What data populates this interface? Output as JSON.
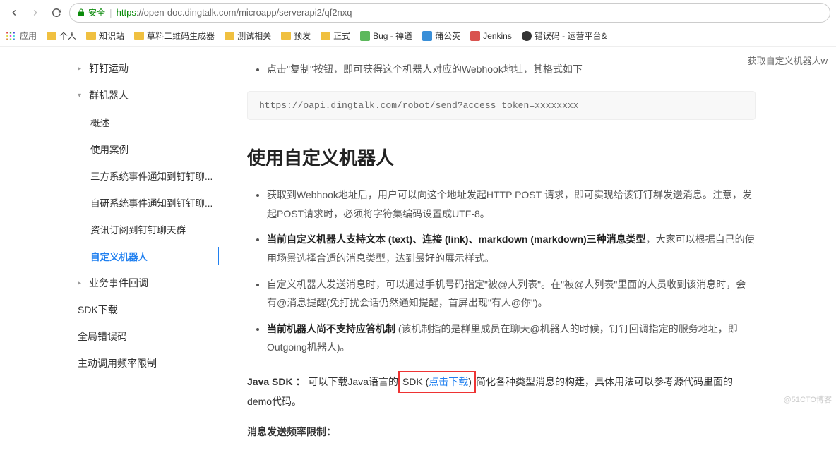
{
  "browser": {
    "secure_label": "安全",
    "url_proto": "https",
    "url_host": "://open-doc.dingtalk.com",
    "url_path": "/microapp/serverapi2/qf2nxq"
  },
  "bookmarks": {
    "apps": "应用",
    "items": [
      {
        "type": "folder",
        "label": "个人"
      },
      {
        "type": "folder",
        "label": "知识站"
      },
      {
        "type": "folder",
        "label": "草料二维码生成器"
      },
      {
        "type": "folder",
        "label": "测试相关"
      },
      {
        "type": "folder",
        "label": "预发"
      },
      {
        "type": "folder",
        "label": "正式"
      },
      {
        "type": "fav",
        "cls": "green",
        "label": "Bug - 禅道"
      },
      {
        "type": "fav",
        "cls": "blue",
        "label": "蒲公英"
      },
      {
        "type": "fav",
        "cls": "red",
        "label": "Jenkins"
      },
      {
        "type": "fav",
        "cls": "yin",
        "label": "错误码 - 运营平台&"
      }
    ]
  },
  "right_header": "获取自定义机器人w",
  "sidebar": {
    "items": [
      {
        "level": "sub",
        "caret": "▸",
        "label": "钉钉运动"
      },
      {
        "level": "sub",
        "caret": "▾",
        "label": "群机器人"
      },
      {
        "level": "sub2",
        "label": "概述"
      },
      {
        "level": "sub2",
        "label": "使用案例"
      },
      {
        "level": "sub2",
        "label": "三方系统事件通知到钉钉聊..."
      },
      {
        "level": "sub2",
        "label": "自研系统事件通知到钉钉聊..."
      },
      {
        "level": "sub2",
        "label": "资讯订阅到钉钉聊天群"
      },
      {
        "level": "sub2",
        "label": "自定义机器人",
        "active": true
      },
      {
        "level": "sub",
        "caret": "▸",
        "label": "业务事件回调"
      },
      {
        "level": "sub",
        "label": "SDK下载"
      },
      {
        "level": "sub",
        "label": "全局错误码"
      },
      {
        "level": "sub",
        "label": "主动调用频率限制"
      }
    ]
  },
  "content": {
    "intro_bullet": "点击\"复制\"按钮，即可获得这个机器人对应的Webhook地址，其格式如下",
    "code": "https://oapi.dingtalk.com/robot/send?access_token=xxxxxxxx",
    "h2": "使用自定义机器人",
    "li1": "获取到Webhook地址后，用户可以向这个地址发起HTTP POST 请求，即可实现给该钉钉群发送消息。注意，发起POST请求时，必须将字符集编码设置成UTF-8。",
    "li2_strong": "当前自定义机器人支持文本 (text)、连接 (link)、markdown (markdown)三种消息类型",
    "li2_rest": "，大家可以根据自己的使用场景选择合适的消息类型，达到最好的展示样式。",
    "li3": "自定义机器人发送消息时，可以通过手机号码指定\"被@人列表\"。在\"被@人列表\"里面的人员收到该消息时，会有@消息提醒(免打扰会话仍然通知提醒，首屏出现\"有人@你\")。",
    "li4_strong": "当前机器人尚不支持应答机制",
    "li4_rest": " (该机制指的是群里成员在聊天@机器人的时候，钉钉回调指定的服务地址，即Outgoing机器人)。",
    "sdk_label": "Java SDK ：",
    "sdk_pre": "可以下载Java语言的",
    "sdk_box_a": "SDK (",
    "sdk_link": "点击下载",
    "sdk_box_b": ") ",
    "sdk_post": "简化各种类型消息的构建，具体用法可以参考源代码里面的demo代码。",
    "rate_label": "消息发送频率限制："
  },
  "watermark": "@51CTO博客"
}
